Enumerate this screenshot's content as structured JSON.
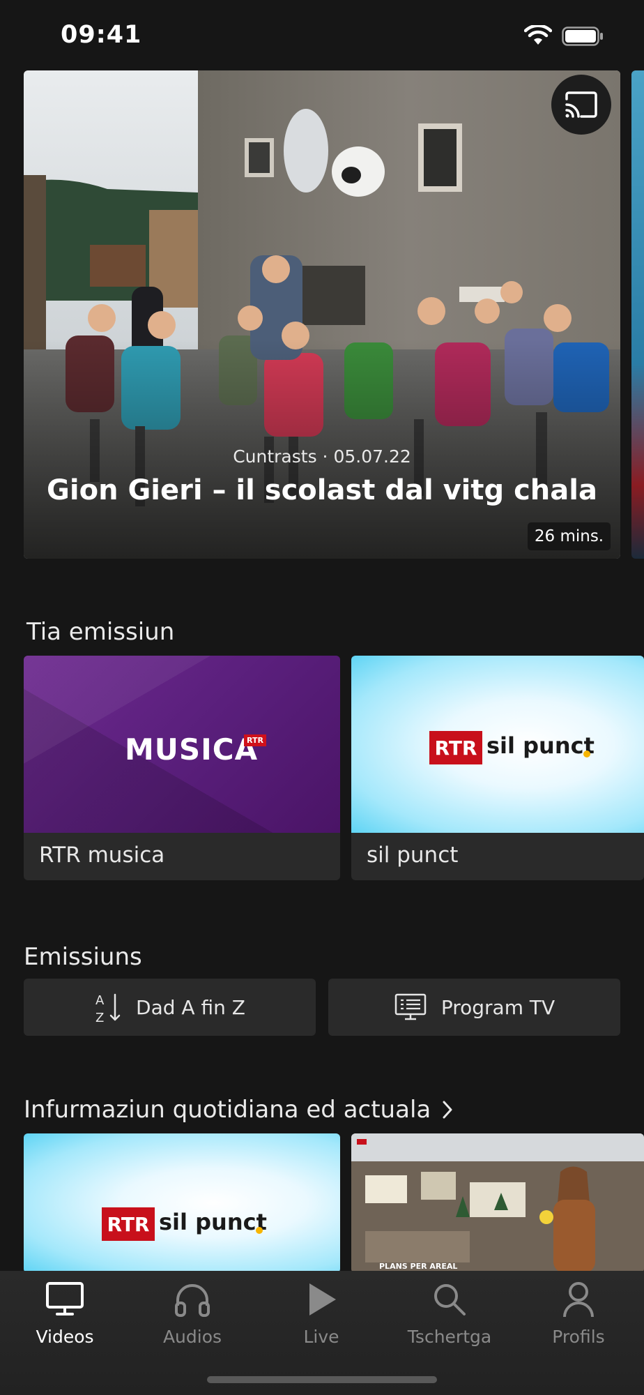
{
  "status_bar": {
    "time": "09:41"
  },
  "hero": {
    "subtitle": "Cuntrasts · 05.07.22",
    "title": "Gion Gieri – il scolast dal vitg chala",
    "duration": "26 mins."
  },
  "my_shows": {
    "title": "Tia emissiun",
    "items": [
      {
        "label": "RTR musica",
        "logo_text": "MUSICA",
        "logo_badge": "RTR"
      },
      {
        "label": "sil punct",
        "logo_box": "RTR",
        "logo_text": "sil punct"
      }
    ]
  },
  "shows": {
    "title": "Emissiuns",
    "buttons": [
      {
        "label": "Dad A fin Z",
        "icon": "sort-az-icon"
      },
      {
        "label": "Program TV",
        "icon": "tv-program-icon"
      }
    ]
  },
  "news": {
    "title": "Infurmaziun quotidiana ed actuala",
    "items": [
      {
        "logo_box": "RTR",
        "logo_text": "sil punct"
      },
      {
        "overlay_text": "PLANS PER AREAL"
      }
    ]
  },
  "tabs": [
    {
      "label": "Videos",
      "icon": "monitor-icon",
      "active": true
    },
    {
      "label": "Audios",
      "icon": "headphones-icon",
      "active": false
    },
    {
      "label": "Live",
      "icon": "play-icon",
      "active": false
    },
    {
      "label": "Tschertga",
      "icon": "search-icon",
      "active": false
    },
    {
      "label": "Profils",
      "icon": "profile-icon",
      "active": false
    }
  ]
}
